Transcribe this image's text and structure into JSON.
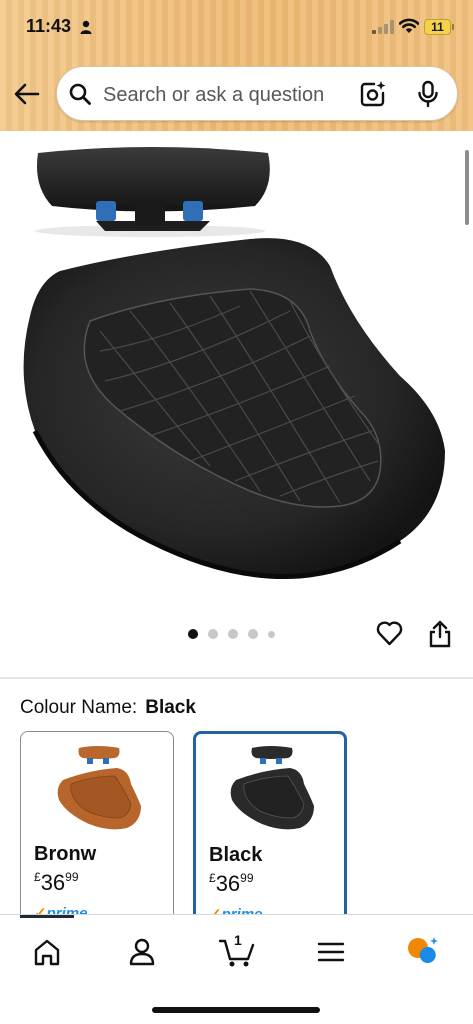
{
  "status_bar": {
    "time": "11:43",
    "battery": "11"
  },
  "search": {
    "placeholder": "Search or ask a question"
  },
  "gallery": {
    "dots": [
      {
        "active": true,
        "size": "normal"
      },
      {
        "active": false,
        "size": "normal"
      },
      {
        "active": false,
        "size": "normal"
      },
      {
        "active": false,
        "size": "normal"
      },
      {
        "active": false,
        "size": "small"
      }
    ]
  },
  "colour": {
    "label": "Colour Name:",
    "value": "Black"
  },
  "swatches": [
    {
      "name": "Bronw",
      "currency": "£",
      "whole": "36",
      "fraction": "99",
      "prime": "prime",
      "color": "#b7652b",
      "selected": false
    },
    {
      "name": "Black",
      "currency": "£",
      "whole": "36",
      "fraction": "99",
      "prime": "prime",
      "color": "#2a2a2a",
      "selected": true
    }
  ],
  "bottom_nav": {
    "cart_count": "1"
  },
  "colors": {
    "header_accent": "#f0bf78",
    "selected_border": "#2162a1",
    "prime_blue": "#1e90e0"
  }
}
